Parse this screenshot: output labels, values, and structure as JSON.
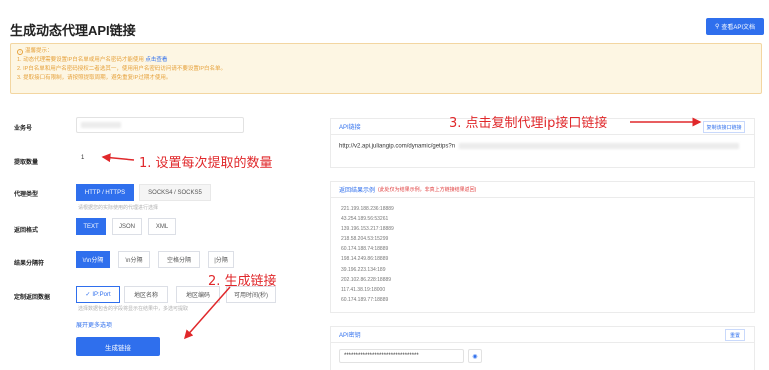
{
  "page": {
    "title": "生成动态代理API链接"
  },
  "doc_button": {
    "label": "查看API文档",
    "icon": "search-icon"
  },
  "notice": {
    "title": "温馨提示：",
    "lines": [
      "1. 动态代理需要设置IP白名单或用户名密码才能使用",
      "2. IP白名单和用户名密码授权二者选其一，使用用户名密码访问请不要设置IP白名单。",
      "3. 提取接口有限制，请按照提取周期，避免重复IP过期才使用。"
    ],
    "link": "点击查看"
  },
  "form": {
    "order_label": "业务号",
    "count_label": "提取数量",
    "count_value": "1",
    "proxy_type_label": "代理类型",
    "proxy_types": [
      "HTTP / HTTPS",
      "SOCKS4 / SOCKS5"
    ],
    "proxy_type_hint": "请根据您的实际使用的代理进行选择",
    "format_label": "返回格式",
    "formats": [
      "TEXT",
      "JSON",
      "XML"
    ],
    "separator_label": "结果分隔符",
    "separators": [
      "\\r\\n分隔",
      "\\n分隔",
      "空格分隔",
      "|分隔"
    ],
    "custom_label": "定制返回数据",
    "custom_options": [
      "IP:Port",
      "地区名称",
      "地区编码",
      "可用时间(秒)"
    ],
    "custom_hint": "选择数据包含的字段将显示在结果中，多选可提取",
    "expand_link": "展开更多选项",
    "generate_button": "生成链接"
  },
  "api_panel": {
    "title": "API链接",
    "copy_button": "复制该接口链接",
    "url": "http://v2.api.juliangip.com/dynamic/getips?n"
  },
  "result_panel": {
    "title": "返回结果示例",
    "note": "(此处仅为结果示例，非真上方链接结果返回)",
    "ips": [
      "221.199.188.236:18889",
      "43.254.189.56:53261",
      "139.196.153.217:18889",
      "218.58.204.53:15299",
      "60.174.188.74:18889",
      "198.14.249.86:18889",
      "39.196.223.134:189",
      "202.102.86.228:18889",
      "117.41.38.19:18000",
      "60.174.189.77:18889"
    ]
  },
  "secret_panel": {
    "title": "API密钥",
    "reset_button": "重置",
    "secret_value": "********************************",
    "eye_icon": "eye-icon"
  },
  "annotations": {
    "step1": "1. 设置每次提取的数量",
    "step2": "2. 生成链接",
    "step3": "3. 点击复制代理ip接口链接"
  },
  "colors": {
    "primary": "#2f6fed",
    "annotation": "#e0282b",
    "notice_bg": "#fdf6e3",
    "notice_text": "#e6a23c"
  }
}
